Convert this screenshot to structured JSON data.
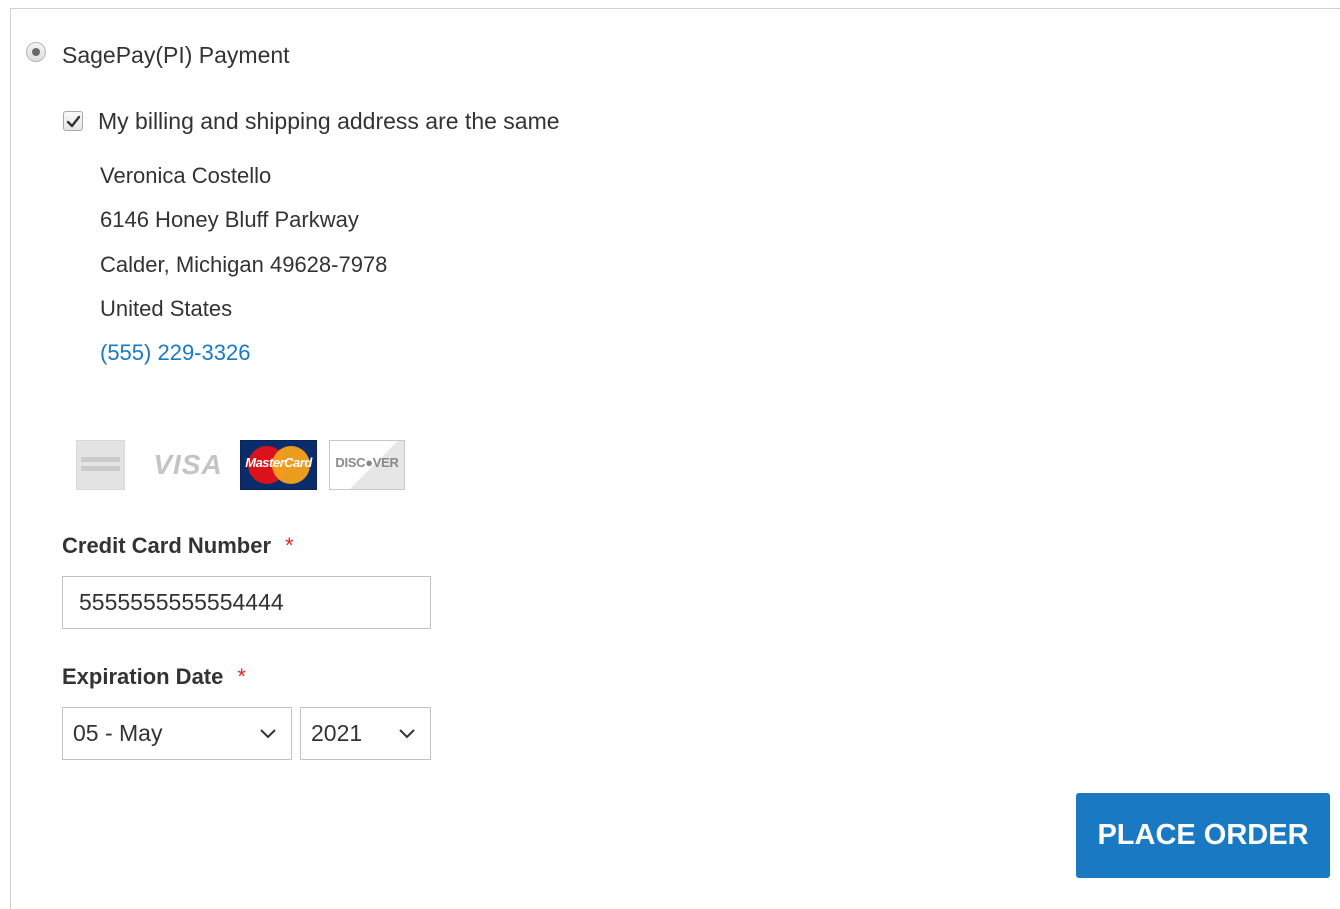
{
  "payment_method": {
    "title": "SagePay(PI) Payment",
    "selected": true
  },
  "billing": {
    "same_as_shipping_label": "My billing and shipping address are the same",
    "same_as_shipping_checked": true,
    "address": {
      "name": "Veronica Costello",
      "street": "6146 Honey Bluff Parkway",
      "city_line": "Calder, Michigan 49628-7978",
      "country": "United States",
      "phone": "(555) 229-3326"
    }
  },
  "card_logos": {
    "visa_text": "VISA",
    "mastercard_text": "MasterCard",
    "discover_text": "DISC●VER"
  },
  "form": {
    "cc_number_label": "Credit Card Number",
    "cc_number_value": "5555555555554444",
    "required_marker": "*",
    "expiration_label": "Expiration Date",
    "exp_month_value": "05 - May",
    "exp_year_value": "2021"
  },
  "actions": {
    "place_order_label": "PLACE ORDER"
  },
  "colors": {
    "link": "#1979c3",
    "button": "#1979c3",
    "required": "#e02b27"
  }
}
